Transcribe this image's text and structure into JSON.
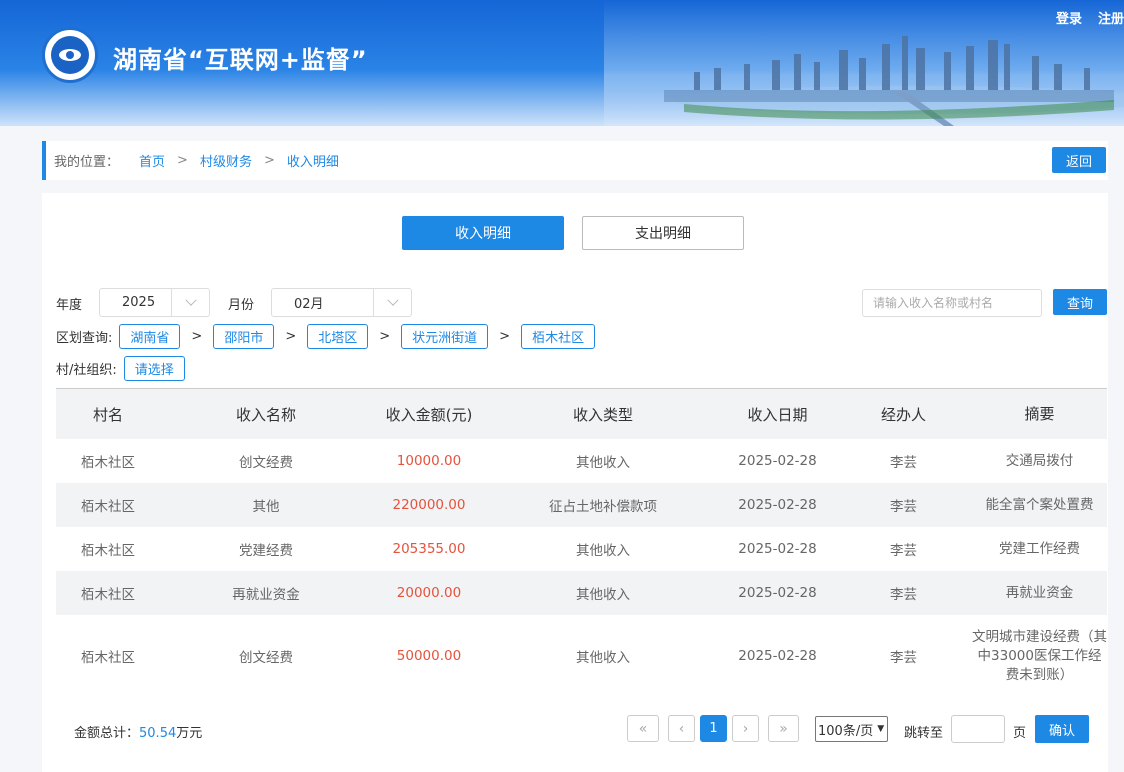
{
  "header": {
    "title": "湖南省“互联网+监督”",
    "login": "登录",
    "register": "注册",
    "logo_icon": "eye-seal-logo"
  },
  "breadcrumb": {
    "label": "我的位置：",
    "items": [
      "首页",
      "村级财务",
      "收入明细"
    ],
    "separator": ">",
    "back": "返回"
  },
  "tabs": {
    "income": "收入明细",
    "expense": "支出明细"
  },
  "filters": {
    "year_label": "年度",
    "year_value": "2025",
    "month_label": "月份",
    "month_value": "02月",
    "search_placeholder": "请输入收入名称或村名",
    "query": "查询",
    "region_label": "区划查询:",
    "regions": [
      "湖南省",
      "邵阳市",
      "北塔区",
      "状元洲街道",
      "栢木社区"
    ],
    "org_label": "村/社组织:",
    "org_value": "请选择"
  },
  "table": {
    "columns": [
      "村名",
      "收入名称",
      "收入金额(元)",
      "收入类型",
      "收入日期",
      "经办人",
      "摘要"
    ],
    "rows": [
      [
        "栢木社区",
        "创文经费",
        "10000.00",
        "其他收入",
        "2025-02-28",
        "李芸",
        "交通局拨付"
      ],
      [
        "栢木社区",
        "其他",
        "220000.00",
        "征占土地补偿款项",
        "2025-02-28",
        "李芸",
        "能全富个案处置费"
      ],
      [
        "栢木社区",
        "党建经费",
        "205355.00",
        "其他收入",
        "2025-02-28",
        "李芸",
        "党建工作经费"
      ],
      [
        "栢木社区",
        "再就业资金",
        "20000.00",
        "其他收入",
        "2025-02-28",
        "李芸",
        "再就业资金"
      ],
      [
        "栢木社区",
        "创文经费",
        "50000.00",
        "其他收入",
        "2025-02-28",
        "李芸",
        "文明城市建设经费（其中33000医保工作经费未到账）"
      ]
    ]
  },
  "footer": {
    "total_label": "金额总计：",
    "total_value": "50.54",
    "total_unit": "万元",
    "first": "«",
    "prev": "‹",
    "current_page": "1",
    "next": "›",
    "last": "»",
    "per_page": "100条/页",
    "jump_label": "跳转至",
    "page_unit": "页",
    "confirm": "确认"
  },
  "colors": {
    "primary": "#1e88e5",
    "amount": "#e5533d"
  }
}
